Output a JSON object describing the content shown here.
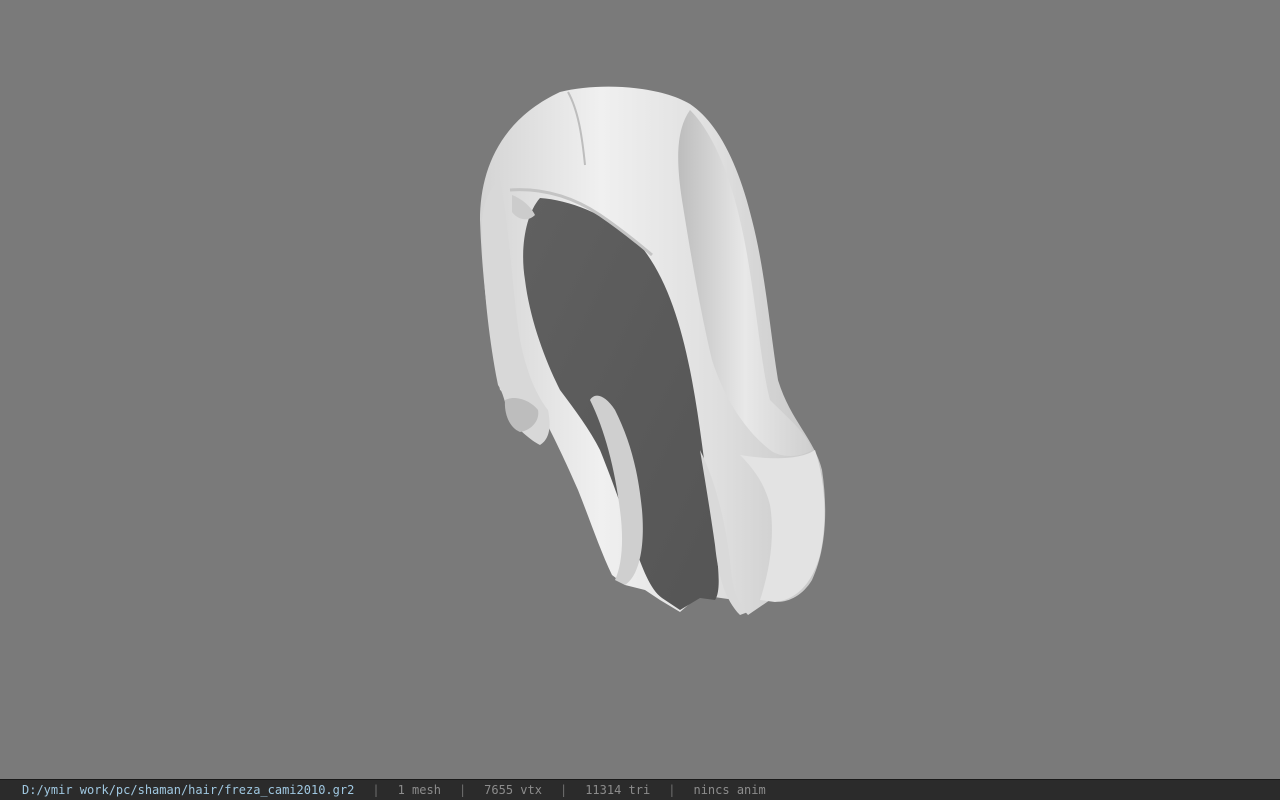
{
  "viewer": {
    "background_color": "#7a7a7a",
    "model_color": "#e6e6e6",
    "model_icon": "hair-mesh-model"
  },
  "status": {
    "file_path": "D:/ymir work/pc/shaman/hair/freza_cami2010.gr2",
    "mesh_count": "1 mesh",
    "vertex_count": "7655 vtx",
    "triangle_count": "11314 tri",
    "anim_info": "nincs anim",
    "separator": "|"
  }
}
